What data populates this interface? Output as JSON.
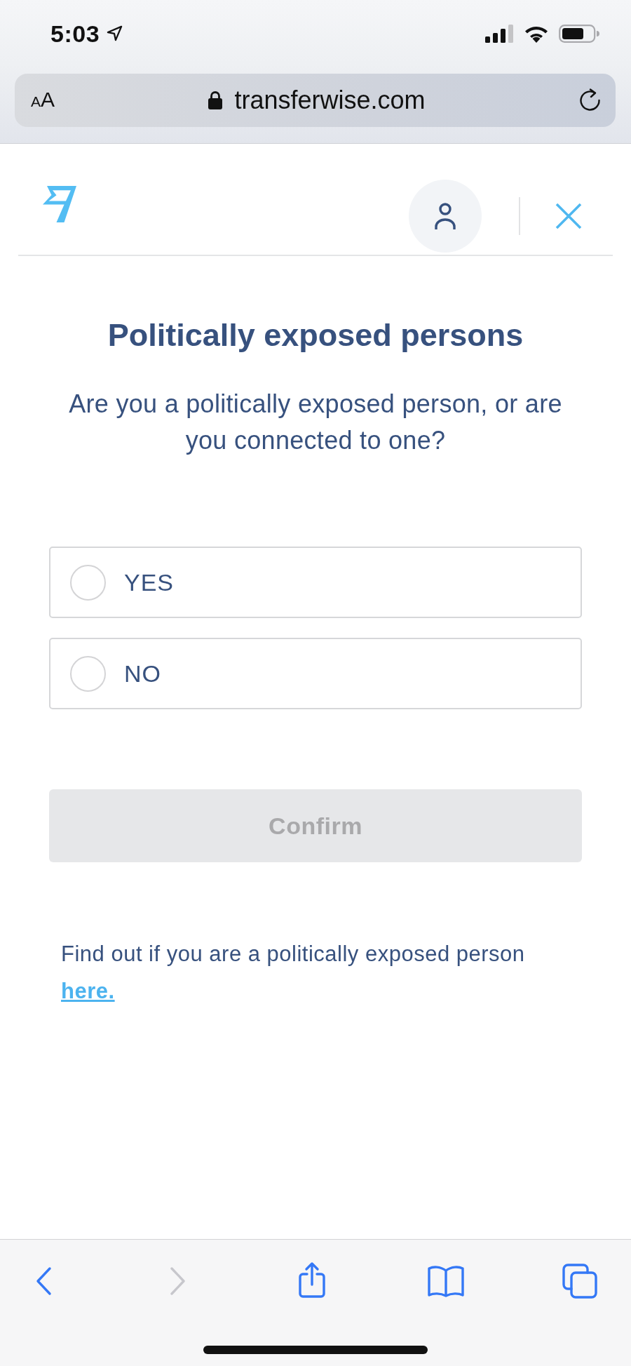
{
  "status_bar": {
    "time": "5:03"
  },
  "address_bar": {
    "text_size_button": "AA",
    "url": "transferwise.com"
  },
  "page": {
    "title": "Politically exposed persons",
    "question": "Are you a politically exposed person, or are you connected to one?",
    "options": [
      {
        "label": "YES",
        "selected": false
      },
      {
        "label": "NO",
        "selected": false
      }
    ],
    "confirm_button": {
      "label": "Confirm",
      "disabled": true
    },
    "help": {
      "text": "Find out if you are a politically exposed person",
      "link": "here."
    }
  },
  "toolbar": [
    {
      "kind": "back",
      "disabled": false
    },
    {
      "kind": "forward",
      "disabled": true
    },
    {
      "kind": "share",
      "disabled": false
    },
    {
      "kind": "bookmarks",
      "disabled": false
    },
    {
      "kind": "tabs",
      "disabled": false
    }
  ]
}
